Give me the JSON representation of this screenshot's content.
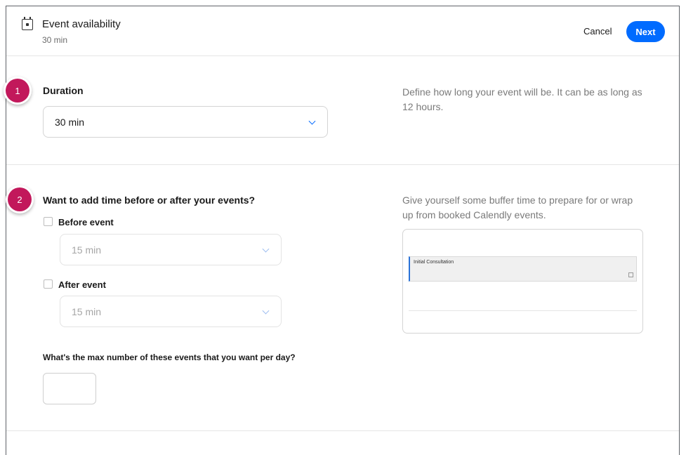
{
  "header": {
    "title": "Event availability",
    "subtitle": "30 min",
    "cancel_label": "Cancel",
    "next_label": "Next"
  },
  "steps": {
    "one": "1",
    "two": "2"
  },
  "duration": {
    "label": "Duration",
    "value": "30 min",
    "help": "Define how long your event will be. It can be as long as 12 hours."
  },
  "buffer": {
    "label": "Want to add time before or after your events?",
    "before_label": "Before event",
    "before_checked": false,
    "before_value": "15 min",
    "after_label": "After event",
    "after_checked": false,
    "after_value": "15 min",
    "help": "Give yourself some buffer time to prepare for or wrap up from booked Calendly events.",
    "preview_event": "Initial Consultation"
  },
  "max_events": {
    "label": "What's the max number of these events that you want per day?",
    "value": ""
  },
  "colors": {
    "accent": "#006bff",
    "badge": "#c2185b"
  }
}
